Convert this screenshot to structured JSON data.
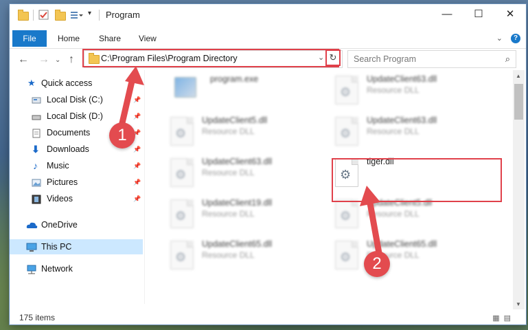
{
  "window": {
    "title": "Program",
    "controls": {
      "minimize": "—",
      "maximize": "☐",
      "close": "✕"
    }
  },
  "ribbon": {
    "file": "File",
    "tabs": [
      "Home",
      "Share",
      "View"
    ]
  },
  "address": {
    "path": "C:\\Program Files\\Program Directory",
    "search_placeholder": "Search Program"
  },
  "nav": {
    "items": [
      {
        "label": "Quick access",
        "icon": "star-icon",
        "pinned": false
      },
      {
        "label": "Local Disk (C:)",
        "icon": "drive-icon",
        "pinned": true
      },
      {
        "label": "Local Disk (D:)",
        "icon": "drive-icon",
        "pinned": true
      },
      {
        "label": "Documents",
        "icon": "documents-icon",
        "pinned": true
      },
      {
        "label": "Downloads",
        "icon": "download-icon",
        "pinned": true
      },
      {
        "label": "Music",
        "icon": "music-icon",
        "pinned": true
      },
      {
        "label": "Pictures",
        "icon": "pictures-icon",
        "pinned": true
      },
      {
        "label": "Videos",
        "icon": "videos-icon",
        "pinned": true
      },
      {
        "label": "OneDrive",
        "icon": "cloud-icon",
        "pinned": false
      },
      {
        "label": "This PC",
        "icon": "computer-icon",
        "pinned": false,
        "selected": true
      },
      {
        "label": "Network",
        "icon": "network-icon",
        "pinned": false
      }
    ]
  },
  "files": [
    {
      "name": "program.exe",
      "desc": "",
      "type": "exe"
    },
    {
      "name": "UpdateClient63.dll",
      "desc": "Resource DLL",
      "type": "dll"
    },
    {
      "name": "UpdateClient5.dll",
      "desc": "Resource DLL",
      "type": "dll"
    },
    {
      "name": "UpdateClient63.dll",
      "desc": "Resource DLL",
      "type": "dll"
    },
    {
      "name": "UpdateClient63.dll",
      "desc": "Resource DLL",
      "type": "dll"
    },
    {
      "name": "tiger.dll",
      "desc": "",
      "type": "dll",
      "highlighted": true
    },
    {
      "name": "UpdateClient19.dll",
      "desc": "Resource DLL",
      "type": "dll"
    },
    {
      "name": "UpdateClient5.dll",
      "desc": "Resource DLL",
      "type": "dll"
    },
    {
      "name": "UpdateClient65.dll",
      "desc": "Resource DLL",
      "type": "dll"
    },
    {
      "name": "UpdateClient65.dll",
      "desc": "Resource DLL",
      "type": "dll"
    }
  ],
  "status": {
    "items": "175 items"
  },
  "annotations": {
    "step1": "1",
    "step2": "2"
  },
  "colors": {
    "highlight": "#e0404a",
    "accent": "#1979ca",
    "selection": "#cce8ff"
  }
}
